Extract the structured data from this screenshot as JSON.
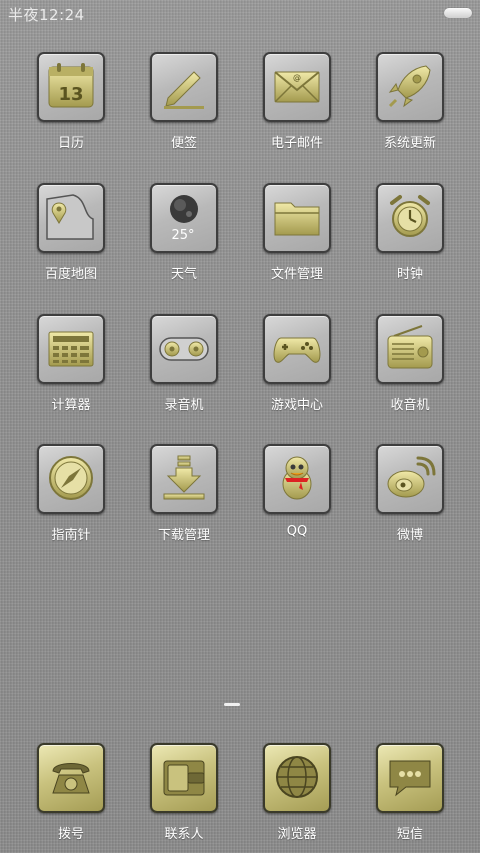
{
  "status": {
    "time": "半夜12:24"
  },
  "apps": [
    {
      "label": "日历",
      "icon": "calendar-icon",
      "day": "13"
    },
    {
      "label": "便签",
      "icon": "pencil-notepad-icon"
    },
    {
      "label": "电子邮件",
      "icon": "envelope-icon"
    },
    {
      "label": "系统更新",
      "icon": "rocket-icon"
    },
    {
      "label": "百度地图",
      "icon": "map-pin-icon"
    },
    {
      "label": "天气",
      "icon": "moon-weather-icon",
      "temp": "25°"
    },
    {
      "label": "文件管理",
      "icon": "folder-icon"
    },
    {
      "label": "时钟",
      "icon": "alarm-clock-icon"
    },
    {
      "label": "计算器",
      "icon": "calculator-icon"
    },
    {
      "label": "录音机",
      "icon": "cassette-icon"
    },
    {
      "label": "游戏中心",
      "icon": "gamepad-icon"
    },
    {
      "label": "收音机",
      "icon": "radio-icon"
    },
    {
      "label": "指南针",
      "icon": "compass-icon"
    },
    {
      "label": "下载管理",
      "icon": "download-arrow-icon"
    },
    {
      "label": "QQ",
      "icon": "qq-penguin-icon"
    },
    {
      "label": "微博",
      "icon": "weibo-icon"
    }
  ],
  "dock": [
    {
      "label": "拨号",
      "icon": "telephone-icon"
    },
    {
      "label": "联系人",
      "icon": "contacts-wallet-icon"
    },
    {
      "label": "浏览器",
      "icon": "globe-icon"
    },
    {
      "label": "短信",
      "icon": "chat-bubble-icon"
    }
  ],
  "colors": {
    "icon_gold": "#d8cf8a",
    "icon_gold_dark": "#8f8745",
    "label": "#ffffff"
  }
}
